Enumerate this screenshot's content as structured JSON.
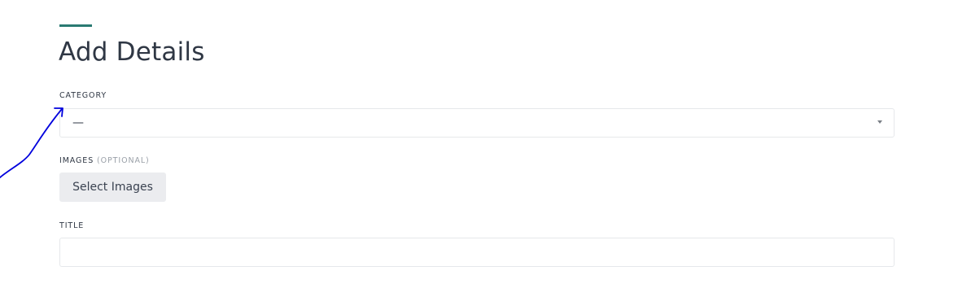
{
  "form": {
    "title": "Add Details",
    "accent_color": "#2a7a72",
    "category": {
      "label": "CATEGORY",
      "selected_value": "—"
    },
    "images": {
      "label": "IMAGES",
      "optional_hint": "(OPTIONAL)",
      "button_label": "Select Images"
    },
    "title_field": {
      "label": "TITLE",
      "value": ""
    }
  },
  "annotation": {
    "arrow_color": "#0000dd"
  }
}
